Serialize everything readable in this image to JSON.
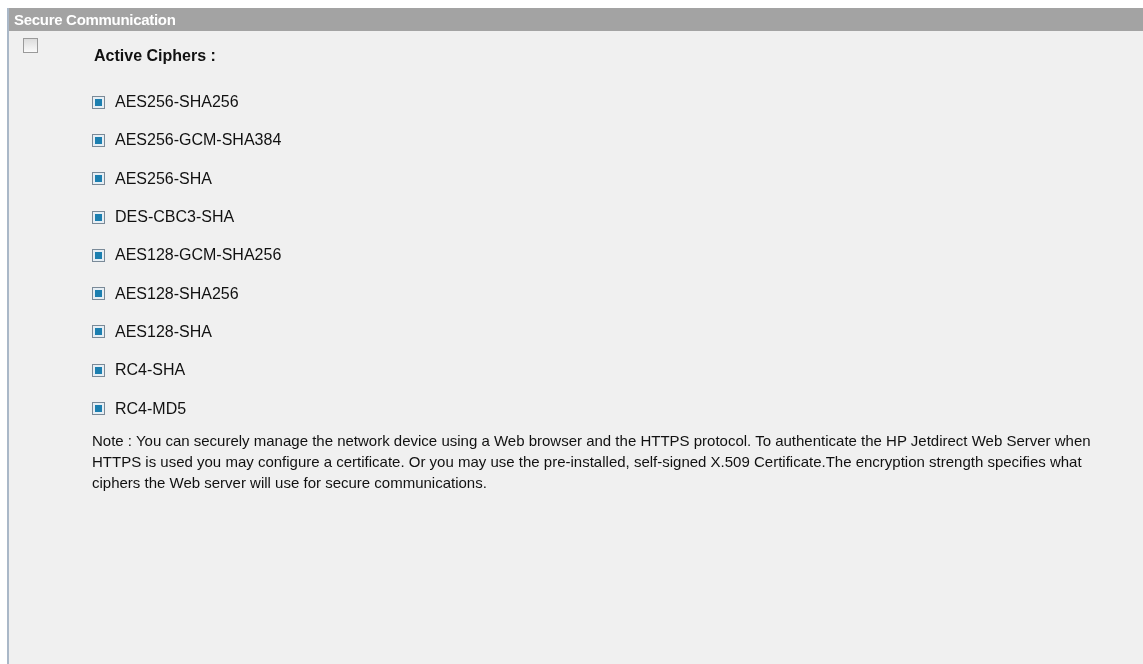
{
  "section": {
    "title": "Secure Communication"
  },
  "master": {
    "checked": false,
    "label": "Active Ciphers :"
  },
  "ciphers": [
    {
      "label": "AES256-SHA256",
      "checked": true
    },
    {
      "label": "AES256-GCM-SHA384",
      "checked": true
    },
    {
      "label": "AES256-SHA",
      "checked": true
    },
    {
      "label": "DES-CBC3-SHA",
      "checked": true
    },
    {
      "label": "AES128-GCM-SHA256",
      "checked": true
    },
    {
      "label": "AES128-SHA256",
      "checked": true
    },
    {
      "label": "AES128-SHA",
      "checked": true
    },
    {
      "label": "RC4-SHA",
      "checked": true
    },
    {
      "label": "RC4-MD5",
      "checked": true
    }
  ],
  "note": "Note : You can securely manage the network device using a Web browser and the HTTPS protocol. To authenticate the HP Jetdirect Web Server when HTTPS is used you may configure a certificate. Or you may use the pre-installed, self-signed X.509 Certificate.The encryption strength specifies what ciphers the Web server will use for secure communications."
}
